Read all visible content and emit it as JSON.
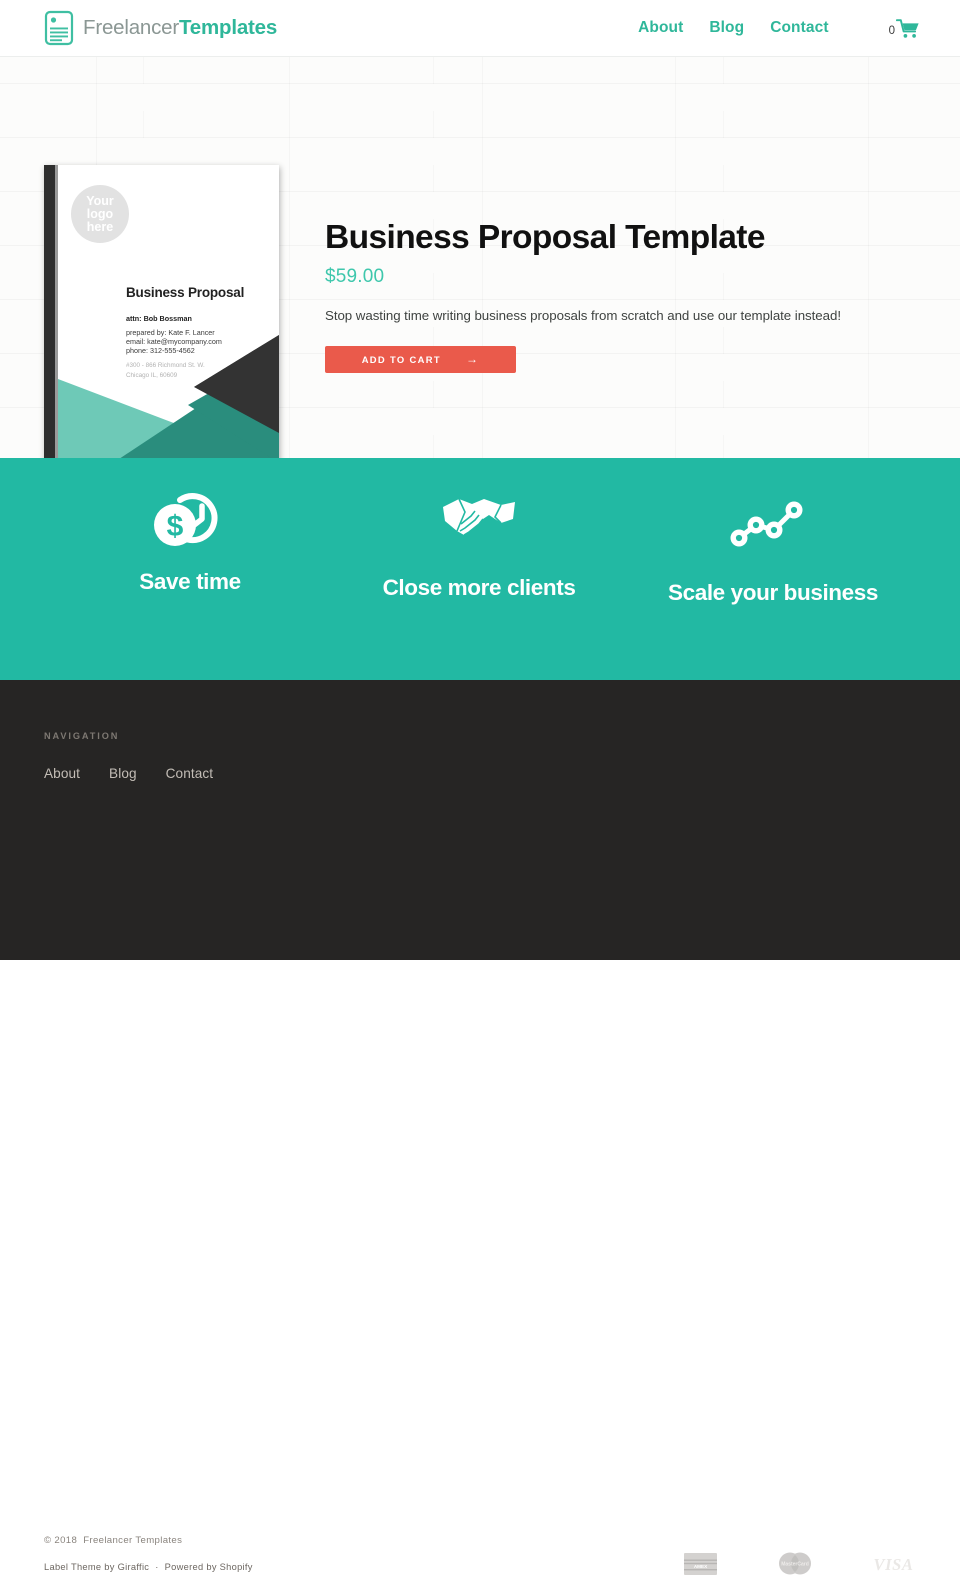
{
  "header": {
    "logo": {
      "part1": "Freelancer",
      "part2": "Templates",
      "icon": "document-icon"
    },
    "nav": [
      {
        "label": "About"
      },
      {
        "label": "Blog"
      },
      {
        "label": "Contact"
      }
    ],
    "cart": {
      "count": "0",
      "icon": "shopping-cart-icon"
    }
  },
  "product": {
    "title": "Business Proposal Template",
    "price": "$59.00",
    "description": "Stop wasting time writing business proposals from scratch and use our template instead!",
    "add_to_cart_label": "ADD TO CART",
    "add_to_cart_arrow": "→",
    "image": {
      "logo_placeholder": [
        "Your",
        "logo",
        "here"
      ],
      "doc_title": "Business Proposal",
      "attn": "attn: Bob Bossman",
      "prepared_by": "prepared by: Kate F. Lancer",
      "email": "email: kate@mycompany.com",
      "phone": "phone: 312-555-4562",
      "address_line1": "#300 - 866 Richmond St. W.",
      "address_line2": "Chicago IL, 60609"
    }
  },
  "features": [
    {
      "label": "Save time",
      "icon": "money-clock-icon"
    },
    {
      "label": "Close more clients",
      "icon": "handshake-icon"
    },
    {
      "label": "Scale your business",
      "icon": "growth-chart-icon"
    }
  ],
  "footer": {
    "nav_heading": "NAVIGATION",
    "links": [
      {
        "label": "About"
      },
      {
        "label": "Blog"
      },
      {
        "label": "Contact"
      }
    ],
    "copyright_year": "© 2018",
    "copyright_name": "Freelancer Templates",
    "theme_credit": "Label Theme by Giraffic",
    "credit_separator": "·",
    "platform_credit": "Powered by Shopify",
    "payments": [
      {
        "name": "american-express"
      },
      {
        "name": "mastercard"
      },
      {
        "name": "visa"
      }
    ]
  },
  "colors": {
    "brand_teal": "#2fb79a",
    "features_band": "#22b9a3",
    "price_teal": "#3ec7ac",
    "cta_red": "#ea5a4b",
    "footer_dark": "#262524"
  }
}
